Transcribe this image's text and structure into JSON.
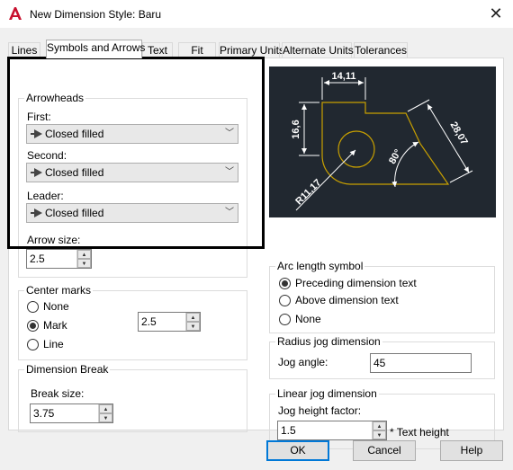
{
  "window": {
    "title": "New Dimension Style: Baru"
  },
  "tabs": [
    {
      "label": "Lines"
    },
    {
      "label": "Symbols and Arrows"
    },
    {
      "label": "Text"
    },
    {
      "label": "Fit"
    },
    {
      "label": "Primary Units"
    },
    {
      "label": "Alternate Units"
    },
    {
      "label": "Tolerances"
    }
  ],
  "arrowheads": {
    "title": "Arrowheads",
    "first_label": "First:",
    "first_value": "Closed filled",
    "second_label": "Second:",
    "second_value": "Closed filled",
    "leader_label": "Leader:",
    "leader_value": "Closed filled",
    "size_label": "Arrow size:",
    "size_value": "2.5"
  },
  "center_marks": {
    "title": "Center marks",
    "options": [
      "None",
      "Mark",
      "Line"
    ],
    "selected": "Mark",
    "size_value": "2.5"
  },
  "dimension_break": {
    "title": "Dimension Break",
    "size_label": "Break size:",
    "size_value": "3.75"
  },
  "preview": {
    "dim_top": "14,11",
    "dim_left": "16,6",
    "dim_right": "28,07",
    "dim_angle": "80°",
    "dim_radius": "R11,17"
  },
  "arc_length": {
    "title": "Arc length symbol",
    "options": [
      "Preceding dimension text",
      "Above dimension text",
      "None"
    ],
    "selected": "Preceding dimension text"
  },
  "radius_jog": {
    "title": "Radius jog dimension",
    "angle_label": "Jog angle:",
    "angle_value": "45"
  },
  "linear_jog": {
    "title": "Linear jog dimension",
    "factor_label": "Jog height factor:",
    "factor_value": "1.5",
    "suffix": "* Text height"
  },
  "buttons": {
    "ok": "OK",
    "cancel": "Cancel",
    "help": "Help"
  },
  "colors": {
    "accent": "#0078d7",
    "preview_bg": "#212830",
    "geometry": "#c8a000",
    "dimension": "#ffffff",
    "app_icon": "#c8102e"
  }
}
